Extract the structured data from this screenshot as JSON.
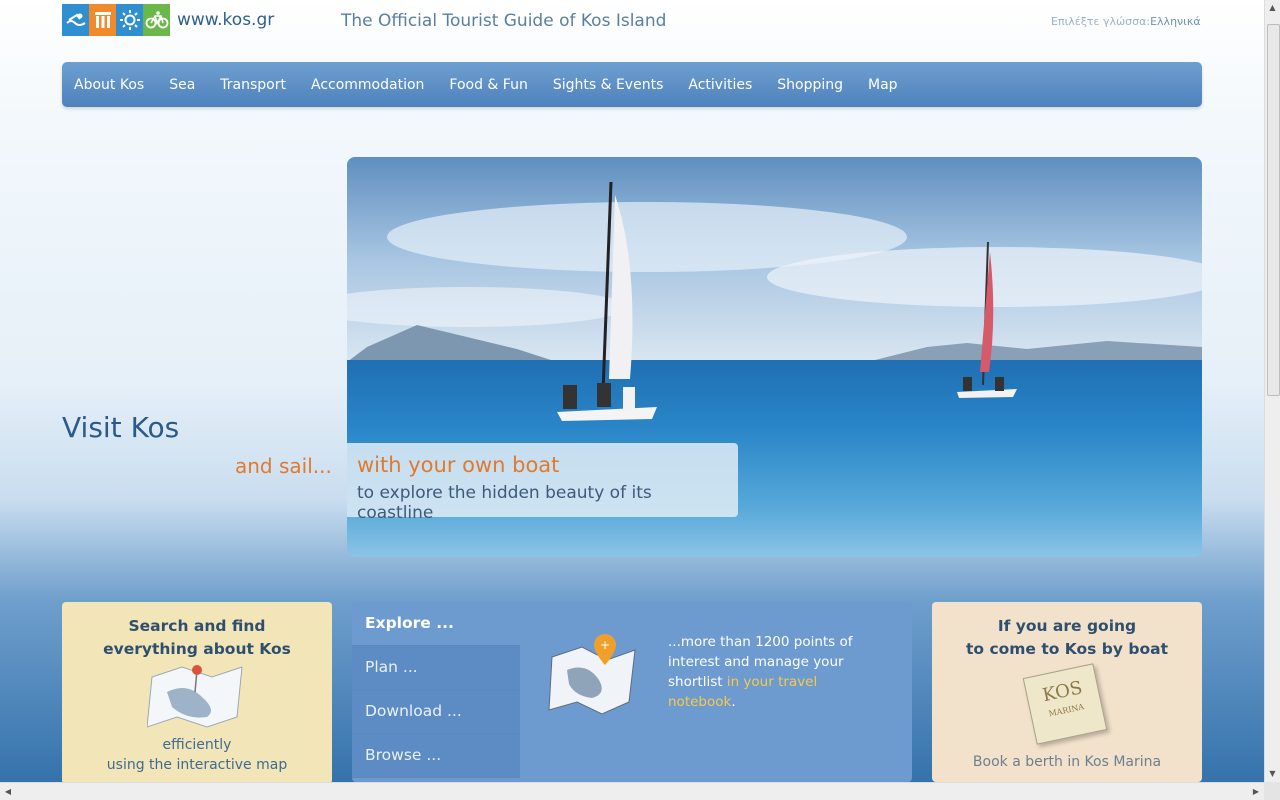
{
  "header": {
    "logo_url_text": "www.kos.gr",
    "tagline": "The Official Tourist Guide of Kos Island",
    "language_label": "Επιλέξτε γλώσσα:",
    "language_value": "Ελληνικά",
    "logo_tile_colors": [
      "#2f8fd0",
      "#f08a2a",
      "#2f8fd0",
      "#6ab84a"
    ]
  },
  "nav": {
    "items": [
      "About Kos",
      "Sea",
      "Transport",
      "Accommodation",
      "Food & Fun",
      "Sights & Events",
      "Activities",
      "Shopping",
      "Map"
    ]
  },
  "hero": {
    "visit_title": "Visit Kos",
    "and_sail": "and sail...",
    "caption_title": "with your own boat",
    "caption_text": "to explore the hidden beauty of its coastline"
  },
  "search_box": {
    "title_line1": "Search and find",
    "title_line2": "everything about Kos",
    "sub_line1": "efficiently",
    "sub_line2": "using the interactive map"
  },
  "explore_box": {
    "tabs": [
      "Explore ...",
      "Plan ...",
      "Download ...",
      "Browse ..."
    ],
    "text_line1": "...more than 1200 points of interest and manage your shortlist",
    "link_text": "in your travel notebook",
    "end_text": "."
  },
  "boat_box": {
    "title_line1": "If you are going",
    "title_line2": "to come to Kos by boat",
    "badge_text": "KOS",
    "badge_sub": "MARINA",
    "cta": "Book a berth in Kos Marina"
  },
  "colors": {
    "accent_orange": "#e07a2e",
    "nav_blue": "#5a8ec6",
    "title_blue": "#2a5a8a"
  }
}
